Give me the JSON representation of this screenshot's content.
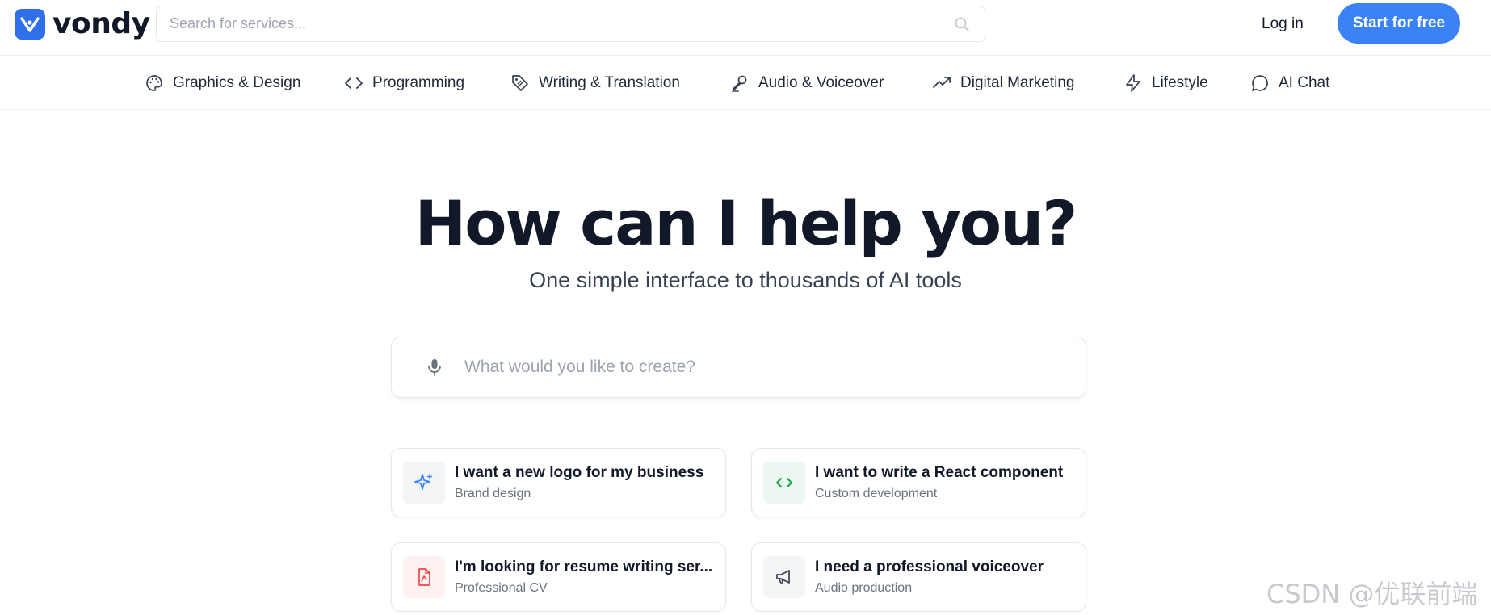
{
  "header": {
    "brand": "vondy",
    "search_placeholder": "Search for services...",
    "login_label": "Log in",
    "start_label": "Start for free",
    "accent_color": "#3b82f6"
  },
  "categories": [
    {
      "label": "Graphics & Design",
      "icon": "palette-icon"
    },
    {
      "label": "Programming",
      "icon": "code-icon"
    },
    {
      "label": "Writing & Translation",
      "icon": "tag-icon"
    },
    {
      "label": "Audio & Voiceover",
      "icon": "microphone-icon"
    },
    {
      "label": "Digital Marketing",
      "icon": "trending-up-icon"
    },
    {
      "label": "Lifestyle",
      "icon": "lightning-icon"
    },
    {
      "label": "AI Chat",
      "icon": "chat-bubble-icon"
    }
  ],
  "hero": {
    "title": "How can I help you?",
    "subtitle": "One simple interface to thousands of AI tools",
    "prompt_placeholder": "What would you like to create?"
  },
  "suggestions": [
    {
      "title": "I want a new logo for my business",
      "subtitle": "Brand design",
      "icon": "sparkle-icon"
    },
    {
      "title": "I want to write a React component",
      "subtitle": "Custom development",
      "icon": "code-icon"
    },
    {
      "title": "I'm looking for resume writing ser...",
      "subtitle": "Professional CV",
      "icon": "document-icon"
    },
    {
      "title": "I need a professional voiceover",
      "subtitle": "Audio production",
      "icon": "megaphone-icon"
    }
  ],
  "watermark": "CSDN @优联前端"
}
